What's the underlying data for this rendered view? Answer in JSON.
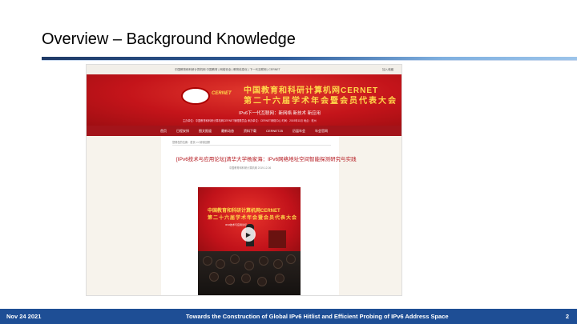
{
  "slide": {
    "title": "Overview – Background Knowledge"
  },
  "screenshot": {
    "topbar": {
      "left": "中国教育和科研计算机网  中国教育  |  网络安全  |  教育信息化  |  下一代互联网  |  CERNET",
      "right": "加入收藏"
    },
    "banner": {
      "logo_text": "CERNET",
      "headline_1": "中国教育和科研计算机网CERNET",
      "headline_2": "第二十六届学术年会暨会员代表大会",
      "subtitle": "IPv6下一代互联网：新网络 新技术 新应用",
      "info": "主办单位：中国教育和科研计算机网CERNET管理委员会    承办单位：CERNET网络中心    时间：2019年11月  地点：杭州"
    },
    "nav": [
      "首页",
      "日程安排",
      "图文报道",
      "最新动态",
      "资料下载",
      "CERNET25",
      "历届年会",
      "年会官网"
    ],
    "article": {
      "breadcrumb": "您现在的位置：首页 >> 精彩回顾",
      "title": "[IPv6技术与应用论坛]清华大学杨家海：IPv6网络地址空间智能探测研究与实践",
      "meta": "中国教育和科研计算机网        2019-12-06"
    },
    "video": {
      "line_1": "中国教育和科研计算机网CERNET",
      "line_2": "第二十六届学术年会暨会员代表大会",
      "line_3": "IPv6技术与应用论坛",
      "play_icon": "play-icon"
    }
  },
  "footer": {
    "date": "Nov 24 2021",
    "title": "Towards the Construction of Global IPv6 Hitlist and Efficient Probing of IPv6 Address Space",
    "page": "2"
  },
  "colors": {
    "accent": "#1e4e95",
    "banner_red": "#c4141a",
    "title_gold": "#ffd84a"
  }
}
